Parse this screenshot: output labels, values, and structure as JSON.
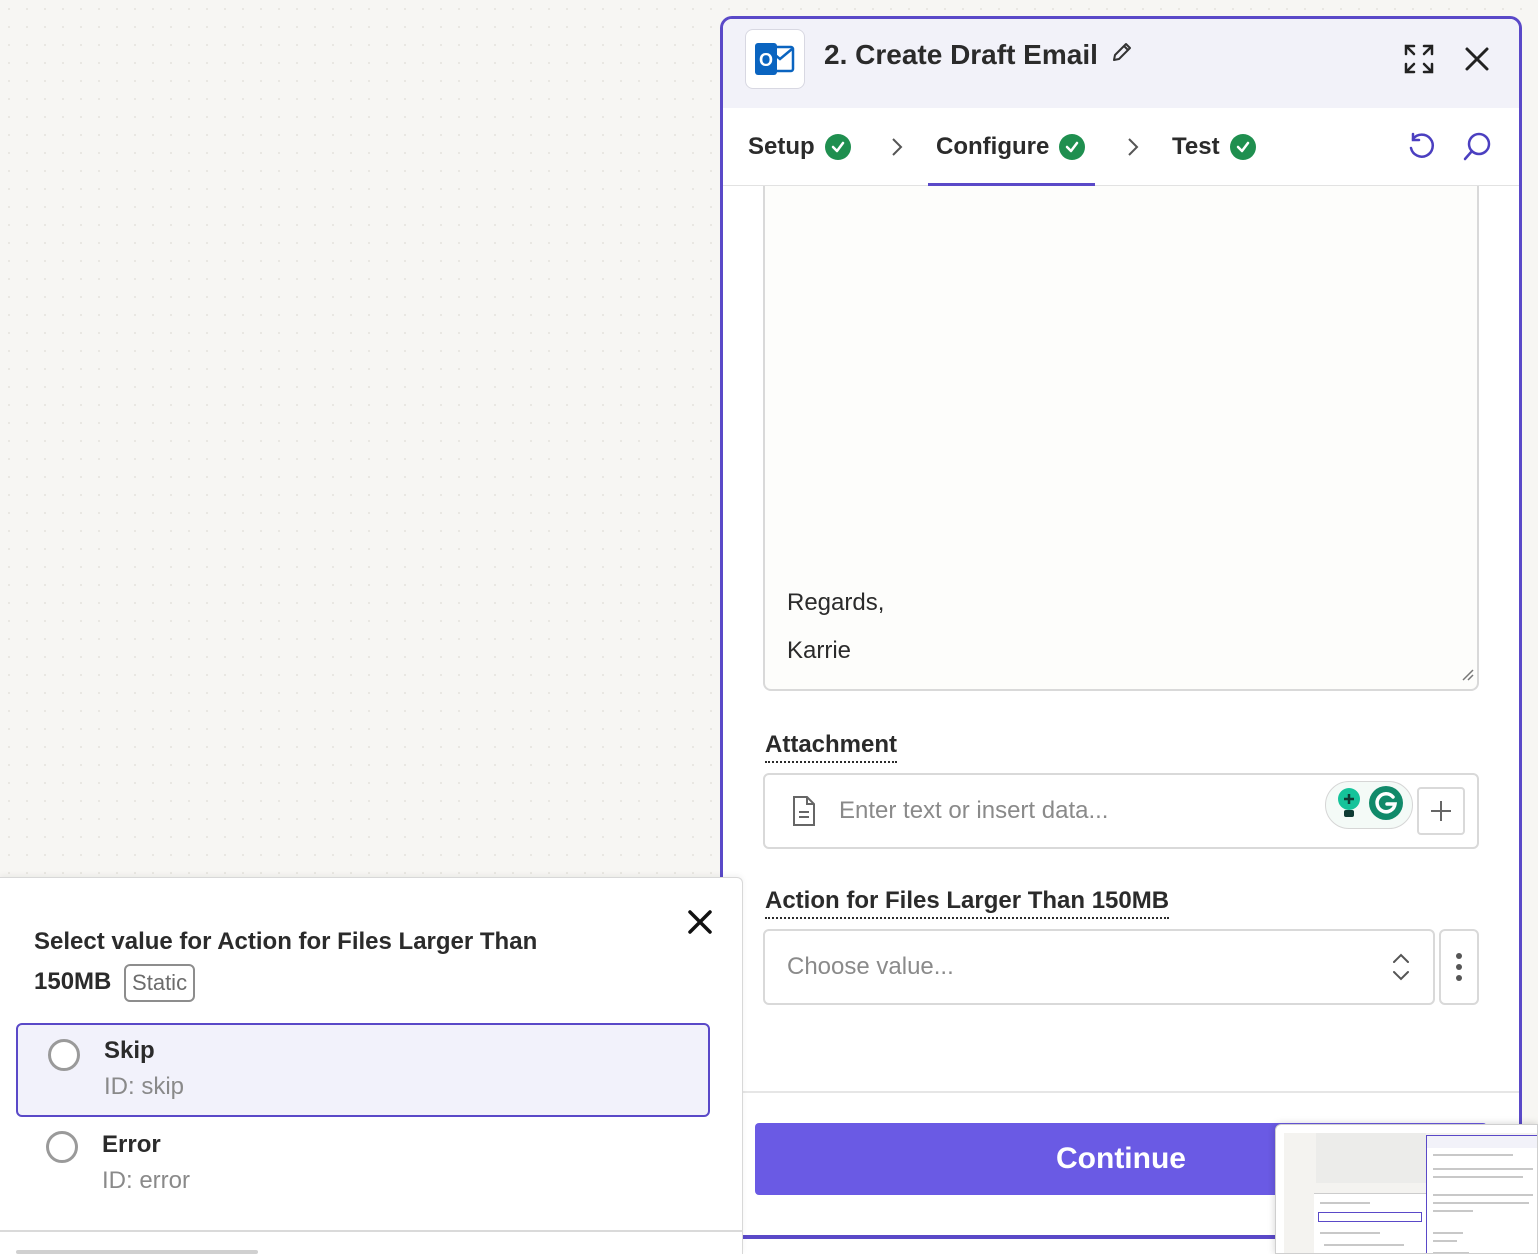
{
  "panel": {
    "step_title": "2. Create Draft Email",
    "app_icon_letter": "O",
    "tabs": [
      {
        "label": "Setup",
        "status": "complete"
      },
      {
        "label": "Configure",
        "status": "complete",
        "active": true
      },
      {
        "label": "Test",
        "status": "complete"
      }
    ]
  },
  "body_field": {
    "lines": [
      "Regards,",
      "Karrie"
    ]
  },
  "attachment": {
    "label": "Attachment",
    "placeholder": "Enter text or insert data..."
  },
  "large_files": {
    "label": "Action for Files Larger Than 150MB",
    "placeholder": "Choose value..."
  },
  "continue_label": "Continue",
  "picker": {
    "title": "Select value for Action for Files Larger Than 150MB",
    "badge": "Static",
    "options": [
      {
        "label": "Skip",
        "id": "ID: skip",
        "highlighted": true
      },
      {
        "label": "Error",
        "id": "ID: error",
        "highlighted": false
      }
    ]
  },
  "colors": {
    "accent": "#5a49c8",
    "button": "#6a5ae4",
    "success": "#1f8f4f",
    "outlook_blue": "#0a64c0"
  },
  "icons": [
    "outlook-icon",
    "pencil-icon",
    "expand-icon",
    "close-icon",
    "check-icon",
    "chevron-right-icon",
    "undo-icon",
    "search-icon",
    "document-icon",
    "grammarly-icon",
    "plus-icon",
    "select-arrows-icon",
    "kebab-icon"
  ]
}
